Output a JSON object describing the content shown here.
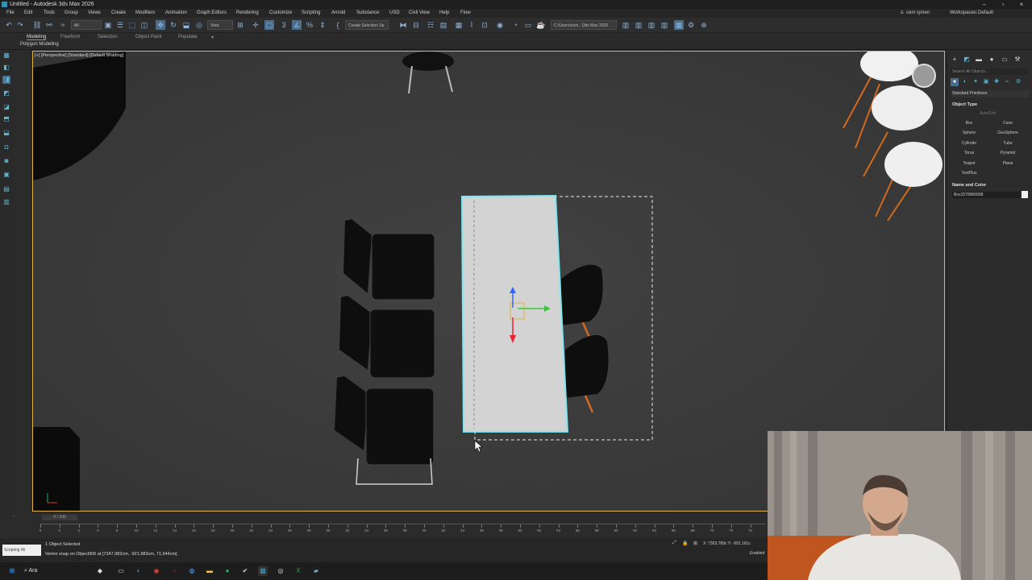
{
  "window": {
    "title": "Untitled - Autodesk 3ds Max 2026"
  },
  "menu": {
    "items": [
      "File",
      "Edit",
      "Tools",
      "Group",
      "Views",
      "Create",
      "Modifiers",
      "Animation",
      "Graph Editors",
      "Rendering",
      "Customize",
      "Scripting",
      "Arnold",
      "Substance",
      "USD",
      "Civil View",
      "Help",
      "Flow"
    ],
    "user": "cem işmen",
    "workspaces_label": "Workspaces:",
    "workspace_value": "Default"
  },
  "toolbar": {
    "filter_value": "All",
    "view_value": "View",
    "selection_set_placeholder": "Create Selection Se",
    "project_path": "C:\\Users\\cem...\\3ds Max 2026"
  },
  "ribbon": {
    "tabs": [
      "Modeling",
      "Freeform",
      "Selection",
      "Object Paint",
      "Populate"
    ],
    "active_panel": "Polygon Modeling"
  },
  "viewport": {
    "label": "[+] [Perspective] [Standard] [Default Shading]"
  },
  "command_panel": {
    "search_placeholder": "Search All Objects...",
    "category": "Standard Primitives",
    "object_type_header": "Object Type",
    "autogrid": "AutoGrid",
    "buttons": [
      "Box",
      "Cone",
      "Sphere",
      "GeoSphere",
      "Cylinder",
      "Tube",
      "Torus",
      "Pyramid",
      "Teapot",
      "Plane",
      "TextPlus"
    ],
    "name_color_header": "Name and Color",
    "name_value": "Box1578966658"
  },
  "timeline": {
    "slider_text": "0 / 100",
    "ticks": [
      0,
      2,
      4,
      6,
      8,
      10,
      12,
      14,
      16,
      18,
      20,
      22,
      24,
      26,
      28,
      30,
      32,
      34,
      36,
      38,
      40,
      42,
      44,
      46,
      48,
      50,
      52,
      54,
      56,
      58,
      60,
      62,
      64,
      66,
      68,
      70,
      72,
      74
    ]
  },
  "status": {
    "maxscript_label": "Scripting Mi",
    "selection": "1 Object Selected",
    "prompt": "Vertex snap on Object906 at [7347,982cm, -921,983cm, 71,944cm]",
    "coords": "X: 7303,789c  Y: -991,161c",
    "enabled": "Enabled"
  },
  "taskbar": {
    "search_text": "Ara"
  },
  "colors": {
    "selection_outline": "#7ee8f0",
    "viewport_border": "#e2b24a",
    "accent": "#5fb6d0"
  }
}
